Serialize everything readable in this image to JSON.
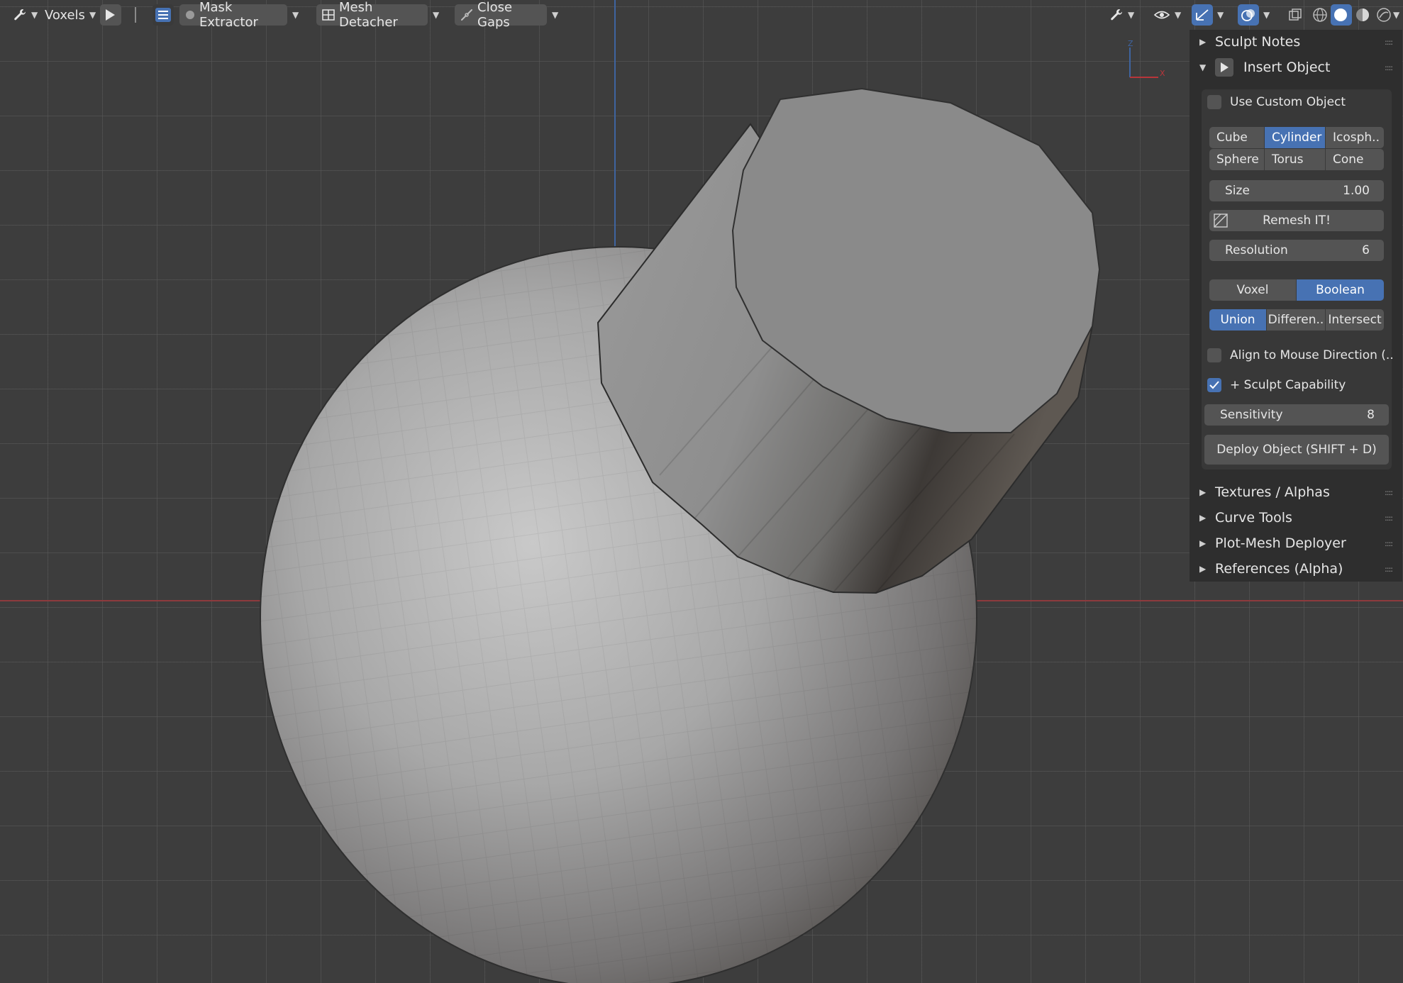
{
  "header": {
    "mode_label": "Voxels",
    "mask_extractor_label": "Mask Extractor",
    "mesh_detacher_label": "Mesh Detacher",
    "close_gaps_label": "Close Gaps"
  },
  "gizmo": {
    "z_label": "Z",
    "x_label": "X"
  },
  "sidebar": {
    "panels_top": [
      {
        "label": "Sculpt Notes",
        "expanded": false
      },
      {
        "label": "Insert Object",
        "expanded": true
      }
    ],
    "insert_object": {
      "use_custom_object": {
        "label": "Use Custom Object",
        "checked": false
      },
      "primitives": {
        "row1": [
          "Cube",
          "Cylinder",
          "Icosph.."
        ],
        "row2": [
          "Sphere",
          "Torus",
          "Cone"
        ],
        "selected": "Cylinder"
      },
      "size": {
        "label": "Size",
        "value": "1.00"
      },
      "remesh_button": "Remesh IT!",
      "resolution": {
        "label": "Resolution",
        "value": "6"
      },
      "method": {
        "options": [
          "Voxel",
          "Boolean"
        ],
        "selected": "Boolean"
      },
      "boolean_op": {
        "options": [
          "Union",
          "Differen..",
          "Intersect"
        ],
        "selected": "Union"
      },
      "align_mouse": {
        "label": "Align to Mouse Direction (..",
        "checked": false
      },
      "sculpt_capability": {
        "label": "+ Sculpt Capability",
        "checked": true
      },
      "sensitivity": {
        "label": "Sensitivity",
        "value": "8"
      },
      "deploy_button": "Deploy Object (SHIFT + D)"
    },
    "panels_bottom": [
      {
        "label": "Textures / Alphas"
      },
      {
        "label": "Curve Tools"
      },
      {
        "label": "Plot-Mesh Deployer"
      },
      {
        "label": "References (Alpha)"
      }
    ]
  },
  "colors": {
    "viewport_bg": "#3d3d3d",
    "panel_bg": "#2e2e2e",
    "widget_bg": "#545454",
    "accent_blue": "#4772b3",
    "axis_x": "#8e3a3d",
    "axis_y": "#3e64a0"
  }
}
